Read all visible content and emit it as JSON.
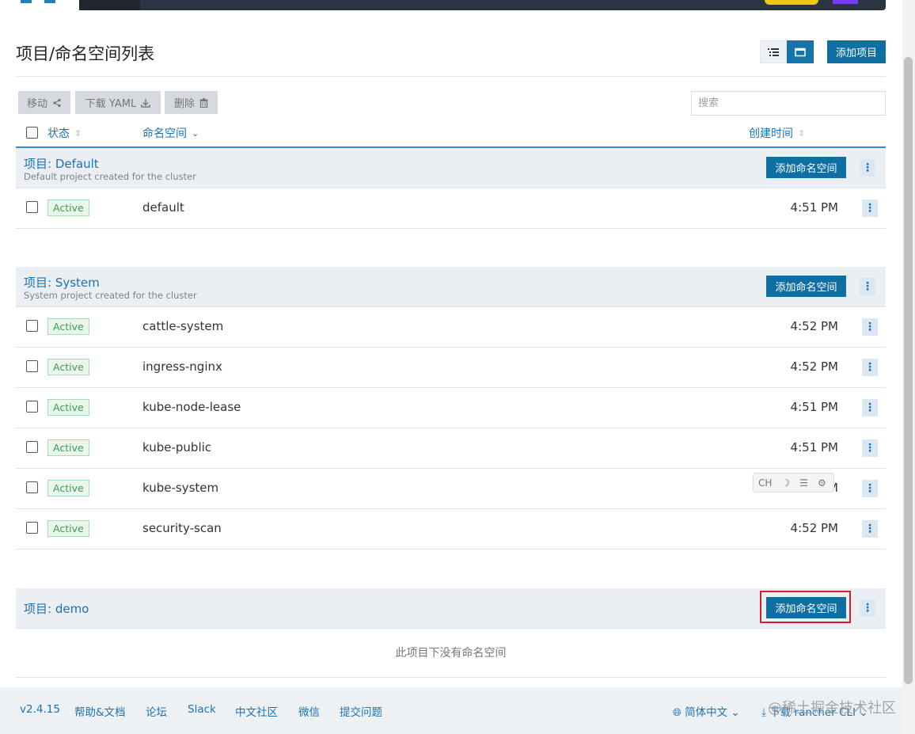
{
  "header": {
    "title": "项目/命名空间列表",
    "add_project_label": "添加项目",
    "view_list_icon": "list-icon",
    "view_group_icon": "folder-icon"
  },
  "toolbar": {
    "move_label": "移动",
    "download_yaml_label": "下载 YAML",
    "delete_label": "删除",
    "search_placeholder": "搜索"
  },
  "columns": {
    "state": "状态",
    "namespace": "命名空间",
    "created": "创建时间"
  },
  "groups": [
    {
      "title": "项目: Default",
      "description": "Default project created for the cluster",
      "add_ns_label": "添加命名空间",
      "rows": [
        {
          "state": "Active",
          "name": "default",
          "time": "4:51 PM"
        }
      ]
    },
    {
      "title": "项目: System",
      "description": "System project created for the cluster",
      "add_ns_label": "添加命名空间",
      "rows": [
        {
          "state": "Active",
          "name": "cattle-system",
          "time": "4:52 PM"
        },
        {
          "state": "Active",
          "name": "ingress-nginx",
          "time": "4:52 PM"
        },
        {
          "state": "Active",
          "name": "kube-node-lease",
          "time": "4:51 PM"
        },
        {
          "state": "Active",
          "name": "kube-public",
          "time": "4:51 PM"
        },
        {
          "state": "Active",
          "name": "kube-system",
          "time": "4:51 PM"
        },
        {
          "state": "Active",
          "name": "security-scan",
          "time": "4:52 PM"
        }
      ]
    },
    {
      "title": "项目: demo",
      "description": "",
      "add_ns_label": "添加命名空间",
      "empty_message": "此项目下没有命名空间",
      "rows": []
    }
  ],
  "ime": {
    "lang": "CH"
  },
  "footer": {
    "version": "v2.4.15",
    "help": "帮助&文档",
    "forum": "论坛",
    "slack": "Slack",
    "community": "中文社区",
    "wechat": "微信",
    "issue": "提交问题",
    "language": "简体中文",
    "download_cli": "下载 rancher CLI",
    "watermark": "@稀土掘金技术社区"
  },
  "colors": {
    "primary": "#0f6fa3",
    "link": "#1a73b6",
    "active_badge": "#3e9b55",
    "highlight": "#d3212a"
  }
}
